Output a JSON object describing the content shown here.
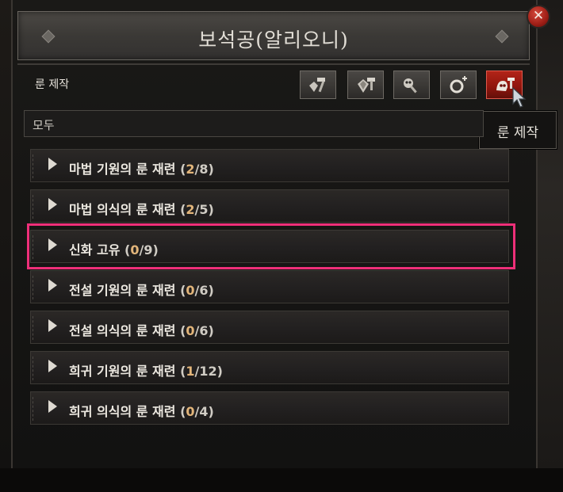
{
  "window": {
    "title": "보석공(알리오니)",
    "close_label": "✕"
  },
  "toolbar": {
    "section_label": "룬 제작",
    "buttons": [
      {
        "name": "gem-craft-button",
        "icon": "hammer-gem-icon"
      },
      {
        "name": "gem-shape-button",
        "icon": "hammer-diamond-icon"
      },
      {
        "name": "skull-craft-button",
        "icon": "hammer-skull-icon"
      },
      {
        "name": "ring-craft-button",
        "icon": "ring-plus-icon"
      },
      {
        "name": "rune-craft-button",
        "icon": "rune-hammer-icon",
        "active": true
      }
    ],
    "tooltip": "룬 제작"
  },
  "filter": {
    "value": "모두"
  },
  "colors": {
    "highlight": "#ee2f79",
    "count_highlight": "#e2b57a",
    "active_button": "#8e150d"
  },
  "categories": [
    {
      "label": "마법 기원의 룬 재련",
      "done": "2",
      "total": "8"
    },
    {
      "label": "마법 의식의 룬 재련",
      "done": "2",
      "total": "5"
    },
    {
      "label": "신화 고유",
      "done": "0",
      "total": "9"
    },
    {
      "label": "전설 기원의 룬 재련",
      "done": "0",
      "total": "6"
    },
    {
      "label": "전설 의식의 룬 재련",
      "done": "0",
      "total": "6"
    },
    {
      "label": "희귀 기원의 룬 재련",
      "done": "1",
      "total": "12"
    },
    {
      "label": "희귀 의식의 룬 재련",
      "done": "0",
      "total": "4"
    }
  ]
}
